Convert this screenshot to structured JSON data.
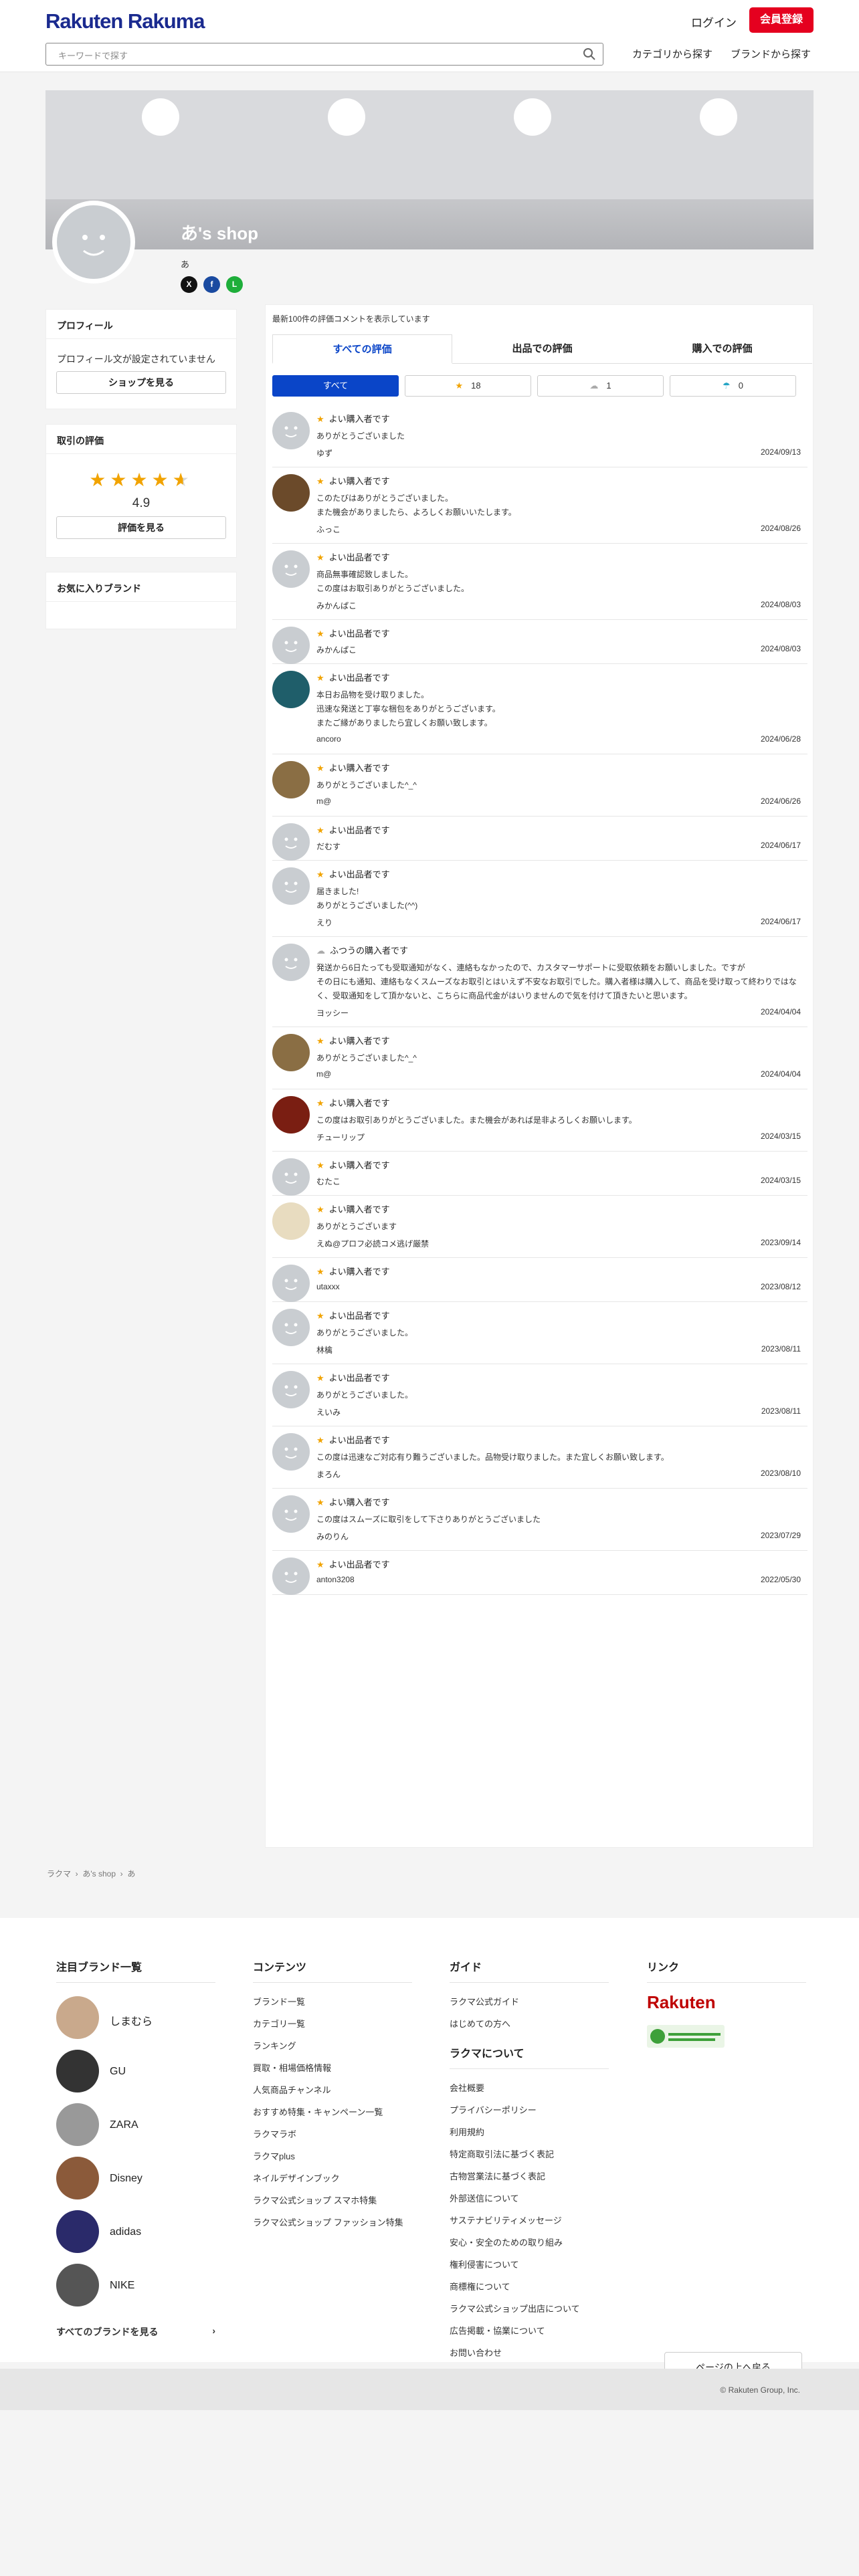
{
  "header": {
    "logo": "Rakuten Rakuma",
    "login": "ログイン",
    "register": "会員登録",
    "search_placeholder": "キーワードで探す",
    "nav": [
      "カテゴリから探す",
      "ブランドから探す"
    ]
  },
  "profile": {
    "shop_name": "あ's shop",
    "sub_name": "あ",
    "sns": [
      "X",
      "f",
      "L"
    ]
  },
  "sidebar": {
    "profile_title": "プロフィール",
    "profile_text": "プロフィール文が設定されていません",
    "shop_button": "ショップを見る",
    "rating_title": "取引の評価",
    "rating_value": "4.9",
    "stars": 4.5,
    "rating_button": "評価を見る",
    "fav_title": "お気に入りブランド"
  },
  "reviews_panel": {
    "notice": "最新100件の評価コメントを表示しています",
    "tabs": [
      "すべての評価",
      "出品での評価",
      "購入での評価"
    ],
    "filters": [
      {
        "label": "すべて",
        "icon": ""
      },
      {
        "label": "18",
        "icon": "★"
      },
      {
        "label": "1",
        "icon": "☁"
      },
      {
        "label": "0",
        "icon": "☂"
      }
    ],
    "items": [
      {
        "kind": "よい購入者です",
        "body": "ありがとうございました",
        "user": "ゆず",
        "date": "2024/09/13"
      },
      {
        "kind": "よい購入者です",
        "body": "このたびはありがとうございました。\nまた機会がありましたら、よろしくお願いいたします。",
        "user": "ふっこ",
        "date": "2024/08/26"
      },
      {
        "kind": "よい出品者です",
        "body": "商品無事確認致しました。\nこの度はお取引ありがとうございました。",
        "user": "みかんぱこ",
        "date": "2024/08/03"
      },
      {
        "kind": "よい出品者です",
        "body": "",
        "user": "みかんぱこ",
        "date": "2024/08/03"
      },
      {
        "kind": "よい出品者です",
        "body": "本日お品物を受け取りました。\n迅速な発送と丁寧な梱包をありがとうございます。\nまたご縁がありましたら宜しくお願い致します。",
        "user": "ancoro",
        "date": "2024/06/28"
      },
      {
        "kind": "よい購入者です",
        "body": "ありがとうございました^_^",
        "user": "m@",
        "date": "2024/06/26"
      },
      {
        "kind": "よい出品者です",
        "body": "",
        "user": "だむす",
        "date": "2024/06/17"
      },
      {
        "kind": "よい出品者です",
        "body": "届きました!\nありがとうございました(^^)",
        "user": "えり",
        "date": "2024/06/17"
      },
      {
        "kind": "ふつうの購入者です",
        "body": "発送から6日たっても受取通知がなく、連絡もなかったので、カスタマーサポートに受取依頼をお願いしました。ですが\nその日にも通知、連絡もなくスムーズなお取引とはいえず不安なお取引でした。購入者様は購入して、商品を受け取って終わりではな\nく、受取通知をして頂かないと、こちらに商品代金がはいりませんので気を付けて頂きたいと思います。",
        "user": "ヨッシー",
        "date": "2024/04/04"
      },
      {
        "kind": "よい購入者です",
        "body": "ありがとうございました^_^",
        "user": "m@",
        "date": "2024/04/04"
      },
      {
        "kind": "よい購入者です",
        "body": "この度はお取引ありがとうございました。また機会があれば是非よろしくお願いします。",
        "user": "チューリップ",
        "date": "2024/03/15"
      },
      {
        "kind": "よい購入者です",
        "body": "",
        "user": "むたこ",
        "date": "2024/03/15"
      },
      {
        "kind": "よい購入者です",
        "body": "ありがとうございます",
        "user": "えぬ@プロフ必読コメ逃げ厳禁",
        "date": "2023/09/14"
      },
      {
        "kind": "よい購入者です",
        "body": "",
        "user": "utaxxx",
        "date": "2023/08/12"
      },
      {
        "kind": "よい出品者です",
        "body": "ありがとうございました。",
        "user": "林檎",
        "date": "2023/08/11"
      },
      {
        "kind": "よい出品者です",
        "body": "ありがとうございました。",
        "user": "えいみ",
        "date": "2023/08/11"
      },
      {
        "kind": "よい出品者です",
        "body": "この度は迅速なご対応有り難うございました。品物受け取りました。また宜しくお願い致します。",
        "user": "まろん",
        "date": "2023/08/10"
      },
      {
        "kind": "よい購入者です",
        "body": "この度はスムーズに取引をして下さりありがとうございました",
        "user": "みのりん",
        "date": "2023/07/29"
      },
      {
        "kind": "よい出品者です",
        "body": "",
        "user": "anton3208",
        "date": "2022/05/30"
      }
    ]
  },
  "breadcrumb": [
    "ラクマ",
    "あ's shop",
    "あ"
  ],
  "footer": {
    "brands_title": "注目ブランド一覧",
    "brands": [
      "しまむら",
      "GU",
      "ZARA",
      "Disney",
      "adidas",
      "NIKE"
    ],
    "all_brands": "すべてのブランドを見る",
    "contents_title": "コンテンツ",
    "contents": [
      "ブランド一覧",
      "カテゴリ一覧",
      "ランキング",
      "買取・相場価格情報",
      "人気商品チャンネル",
      "おすすめ特集・キャンペーン一覧",
      "ラクマラボ",
      "ラクマplus",
      "ネイルデザインブック",
      "ラクマ公式ショップ スマホ特集",
      "ラクマ公式ショップ ファッション特集"
    ],
    "guide_title": "ガイド",
    "guide": [
      "ラクマ公式ガイド",
      "はじめての方へ"
    ],
    "about_title": "ラクマについて",
    "about": [
      "会社概要",
      "プライバシーポリシー",
      "利用規約",
      "特定商取引法に基づく表記",
      "古物営業法に基づく表記",
      "外部送信について",
      "サステナビリティメッセージ",
      "安心・安全のための取り組み",
      "権利侵害について",
      "商標権について",
      "ラクマ公式ショップ出店について",
      "広告掲載・協業について",
      "お問い合わせ"
    ],
    "links_title": "リンク",
    "links_logo": "Rakuten",
    "to_top": "ページの上へ戻る",
    "copyright": "© Rakuten Group, Inc."
  },
  "colors": {
    "accent": "#0a45c8",
    "brand_red": "#e5001f",
    "star": "#f1a300"
  }
}
